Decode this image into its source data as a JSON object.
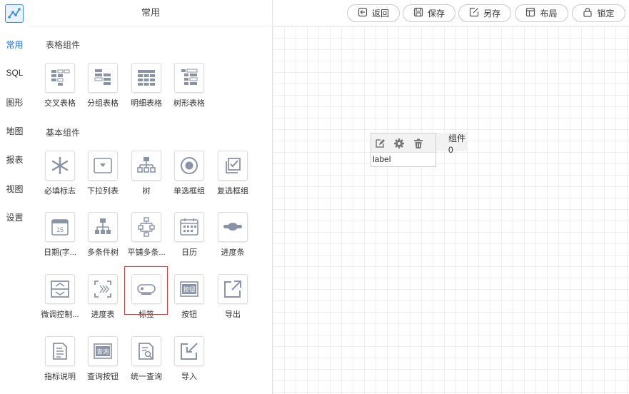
{
  "nav": {
    "items": [
      {
        "label": "常用",
        "active": true
      },
      {
        "label": "SQL"
      },
      {
        "label": "图形"
      },
      {
        "label": "地图"
      },
      {
        "label": "报表"
      },
      {
        "label": "视图"
      },
      {
        "label": "设置"
      }
    ]
  },
  "panel": {
    "title": "常用",
    "sections": [
      {
        "title": "表格组件",
        "items": [
          {
            "label": "交叉表格",
            "icon": "crosstab-icon"
          },
          {
            "label": "分组表格",
            "icon": "group-table-icon"
          },
          {
            "label": "明细表格",
            "icon": "detail-table-icon"
          },
          {
            "label": "树形表格",
            "icon": "tree-table-icon"
          }
        ]
      },
      {
        "title": "基本组件",
        "items": [
          {
            "label": "必填标志",
            "icon": "asterisk-icon"
          },
          {
            "label": "下拉列表",
            "icon": "dropdown-icon"
          },
          {
            "label": "树",
            "icon": "tree-icon"
          },
          {
            "label": "单选框组",
            "icon": "radio-icon"
          },
          {
            "label": "复选框组",
            "icon": "checkbox-icon"
          },
          {
            "label": "日期(字...",
            "icon": "date-icon"
          },
          {
            "label": "多条件树",
            "icon": "multi-tree-icon"
          },
          {
            "label": "平铺多条...",
            "icon": "tiled-tree-icon"
          },
          {
            "label": "日历",
            "icon": "calendar-icon"
          },
          {
            "label": "进度条",
            "icon": "progress-bar-icon"
          },
          {
            "label": "微调控制...",
            "icon": "spinner-icon"
          },
          {
            "label": "进度表",
            "icon": "progress-table-icon"
          },
          {
            "label": "标签",
            "icon": "tag-icon",
            "highlighted": true
          },
          {
            "label": "按钮",
            "icon": "button-icon",
            "text": "按钮"
          },
          {
            "label": "导出",
            "icon": "export-icon"
          },
          {
            "label": "指标说明",
            "icon": "indicator-doc-icon"
          },
          {
            "label": "查询按钮",
            "icon": "query-button-icon",
            "text": "查询"
          },
          {
            "label": "统一查询",
            "icon": "unified-query-icon"
          },
          {
            "label": "导入",
            "icon": "import-icon"
          }
        ]
      }
    ]
  },
  "toolbar": {
    "buttons": [
      {
        "label": "返回",
        "icon": "back-icon"
      },
      {
        "label": "保存",
        "icon": "save-icon"
      },
      {
        "label": "另存",
        "icon": "save-as-icon"
      },
      {
        "label": "布局",
        "icon": "layout-icon"
      },
      {
        "label": "锁定",
        "icon": "lock-icon"
      }
    ]
  },
  "canvas": {
    "widget": {
      "name": "组件0",
      "label_text": "label",
      "tools": [
        "edit-icon",
        "settings-icon",
        "delete-icon"
      ]
    }
  },
  "colors": {
    "accent": "#1e6fd9",
    "icon_gray": "#8a92a6",
    "highlight": "#e03a3a"
  }
}
